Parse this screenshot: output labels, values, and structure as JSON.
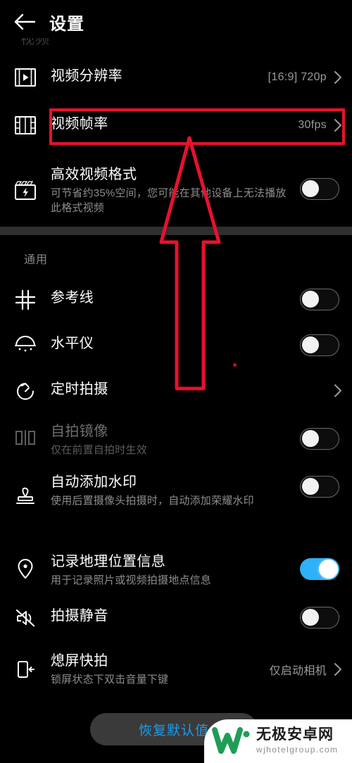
{
  "appbar": {
    "back_icon": "back-arrow-icon",
    "title": "设置"
  },
  "top_faint_label": "视频",
  "sections": [
    {
      "id": "video",
      "label": "视频",
      "rows": [
        {
          "icon": "film-play-icon",
          "title": "视频分辨率",
          "sub": "",
          "value": "[16:9] 720p",
          "control": "chevron"
        },
        {
          "icon": "film-grid-icon",
          "title": "视频帧率",
          "sub": "",
          "value": "30fps",
          "control": "chevron"
        },
        {
          "icon": "clapper-bolt-icon",
          "title": "高效视频格式",
          "sub": "可节省约35%空间，您可能在其他设备上无法播放此格式视频",
          "value": "",
          "control": "toggle-off"
        }
      ]
    },
    {
      "id": "general",
      "label": "通用",
      "rows": [
        {
          "icon": "grid-lines-icon",
          "title": "参考线",
          "sub": "",
          "value": "",
          "control": "toggle-off"
        },
        {
          "icon": "level-meter-icon",
          "title": "水平仪",
          "sub": "",
          "value": "",
          "control": "toggle-off"
        },
        {
          "icon": "timer-icon",
          "title": "定时拍摄",
          "sub": "",
          "value": "",
          "control": "chevron"
        },
        {
          "icon": "mirror-icon",
          "title": "自拍镜像",
          "sub": "仅在前置自拍时生效",
          "value": "",
          "control": "toggle-off",
          "disabled": true
        },
        {
          "icon": "stamp-icon",
          "title": "自动添加水印",
          "sub": "使用后置摄像头拍摄时，自动添加荣耀水印",
          "value": "",
          "control": "toggle-off"
        },
        {
          "icon": "location-pin-icon",
          "title": "记录地理位置信息",
          "sub": "用于记录照片或视频拍摄地点信息",
          "value": "",
          "control": "toggle-on"
        },
        {
          "icon": "mute-speaker-icon",
          "title": "拍摄静音",
          "sub": "",
          "value": "",
          "control": "toggle-off"
        },
        {
          "icon": "phone-quickshot-icon",
          "title": "熄屏快拍",
          "sub": "锁屏状态下双击音量下键",
          "value": "仅启动相机",
          "control": "chevron"
        }
      ]
    }
  ],
  "restore_button": {
    "label": "恢复默认值"
  },
  "annotations": {
    "highlight_target": "视频帧率",
    "arrow_color": "#e8112d",
    "box_color": "#e8112d"
  },
  "watermark": {
    "logo": "w-logo-icon",
    "brand": "无极安卓网",
    "domain": "wjhotelgroup.com"
  },
  "colors": {
    "background": "#000000",
    "toggle_on": "#2eb1f7",
    "accent_link": "#1c9bea",
    "divider": "#2f2f2f",
    "secondary_text": "#8d8d8d"
  }
}
